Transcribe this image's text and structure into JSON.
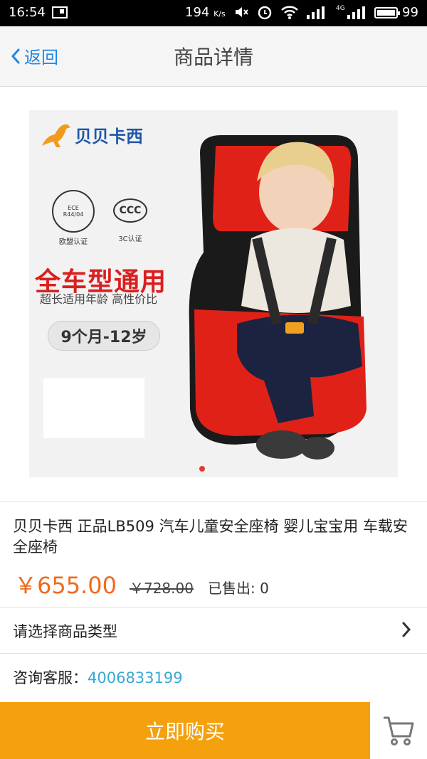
{
  "status_bar": {
    "time": "16:54",
    "speed": "194",
    "speed_unit": "K/s",
    "network": "4G",
    "battery": "99"
  },
  "nav": {
    "back_label": "返回",
    "title": "商品详情"
  },
  "product_image": {
    "brand": "贝贝卡西",
    "cert_ece": "ECE",
    "cert_ece_code": "R44/04",
    "cert_ece_label": "欧盟认证",
    "cert_3c_label": "3C认证",
    "headline": "全车型通用",
    "subline": "超长适用年龄 高性价比",
    "age_range": "9个月-12岁",
    "carousel_active": 1
  },
  "product": {
    "title": "贝贝卡西 正品LB509 汽车儿童安全座椅 婴儿宝宝用 车载安全座椅",
    "price": "￥655.00",
    "original_price": "￥728.00",
    "sold_label": "已售出: 0"
  },
  "options": {
    "select_type_label": "请选择商品类型"
  },
  "contact": {
    "label": "咨询客服：",
    "phone": "4006833199"
  },
  "actions": {
    "buy_label": "立即购买"
  },
  "colors": {
    "accent_blue": "#1e88e5",
    "price_orange": "#f26a1b",
    "buy_button": "#f5a00d",
    "phone_link": "#3aa9d0"
  }
}
